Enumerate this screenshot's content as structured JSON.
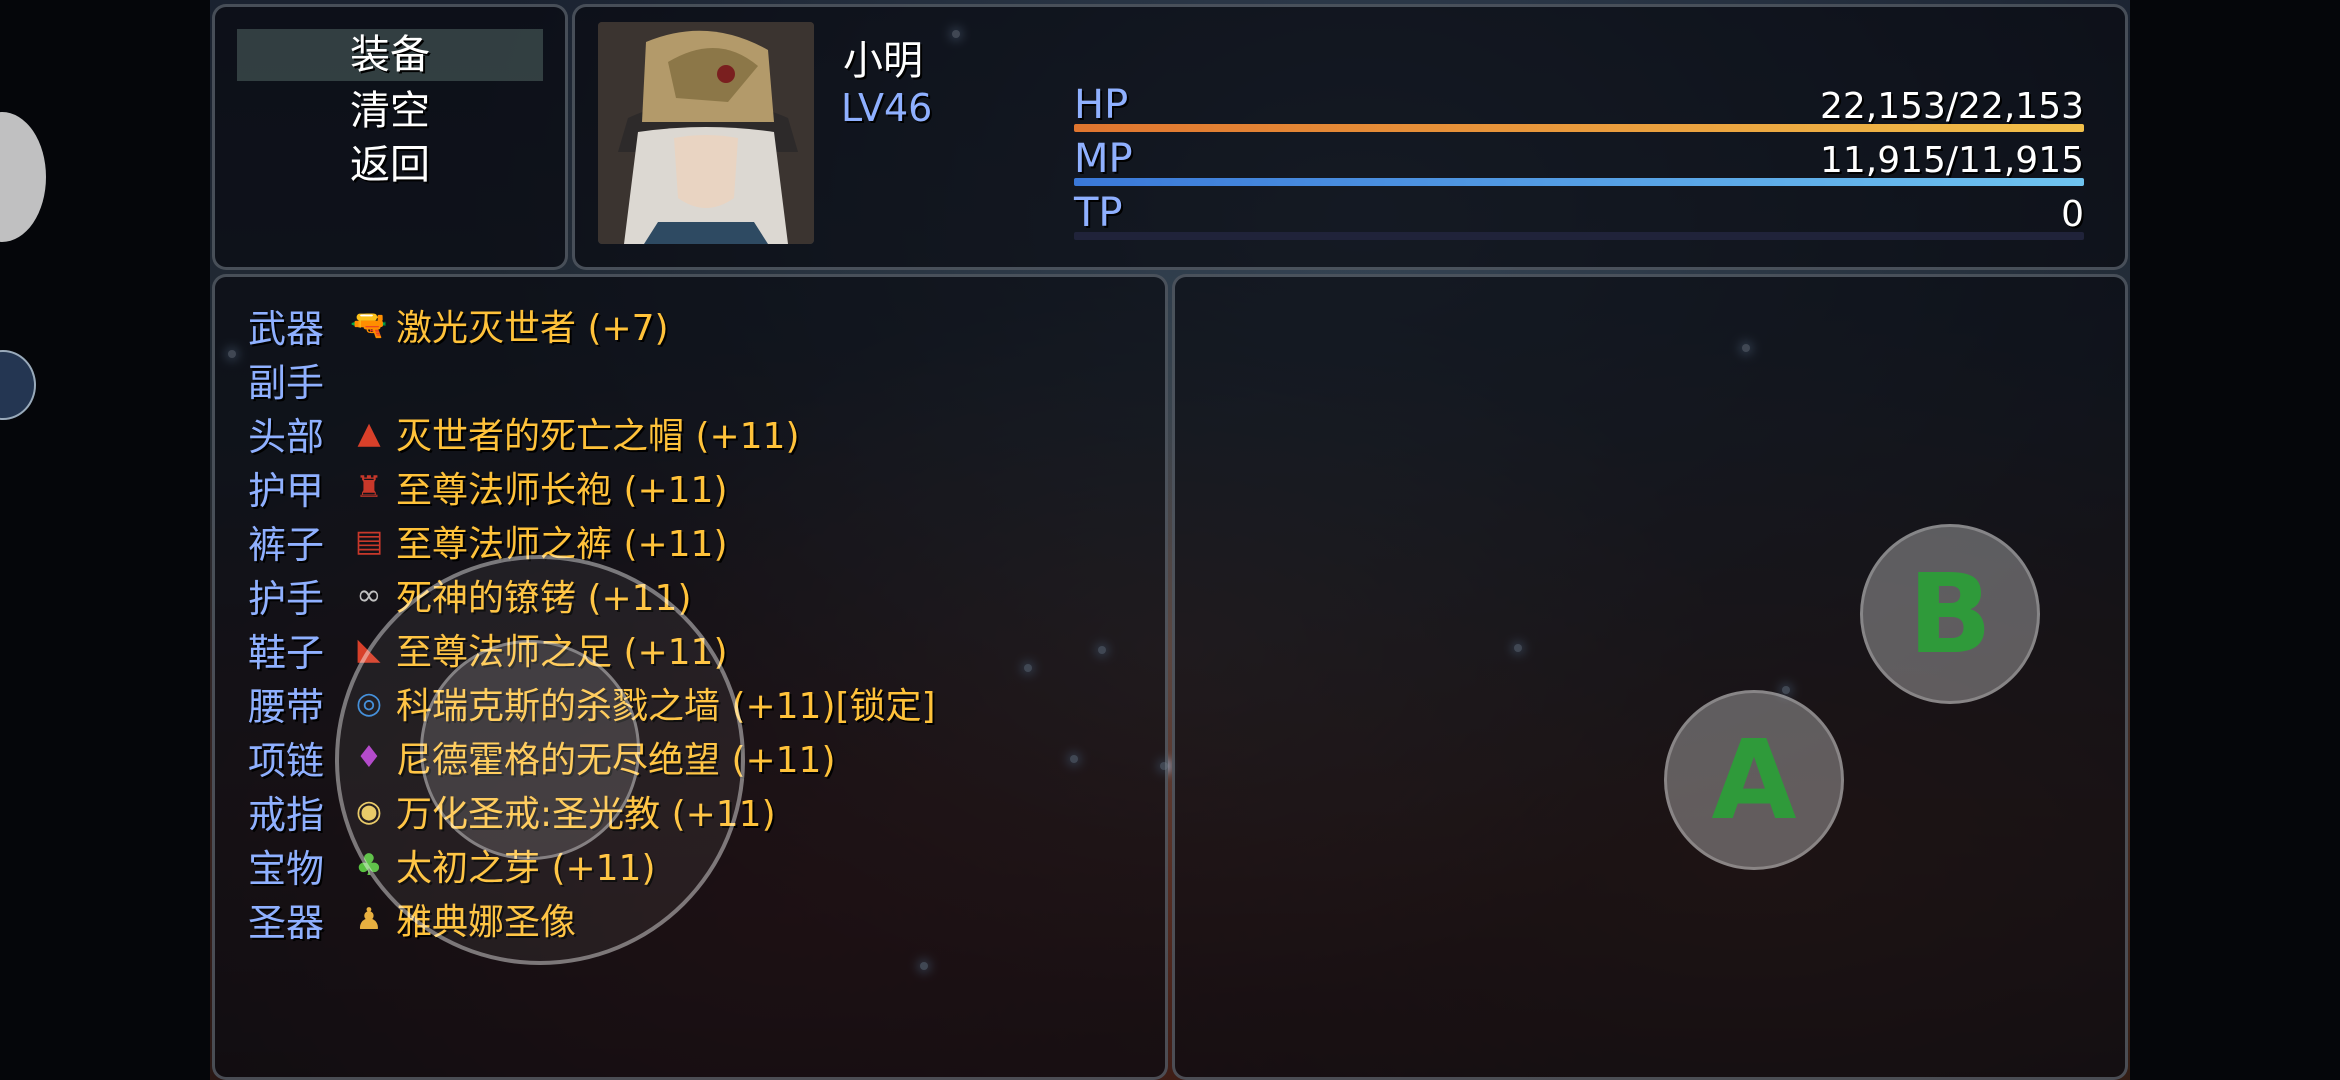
{
  "menu": {
    "items": [
      {
        "label": "装备",
        "selected": true
      },
      {
        "label": "清空",
        "selected": false
      },
      {
        "label": "返回",
        "selected": false
      }
    ]
  },
  "actor": {
    "name": "小明",
    "level": "LV46",
    "hp": {
      "label": "HP",
      "value": "22,153/22,153",
      "ratio": 1.0,
      "colors": [
        "#e0752f",
        "#f2c04a"
      ]
    },
    "mp": {
      "label": "MP",
      "value": "11,915/11,915",
      "ratio": 1.0,
      "colors": [
        "#3a78d8",
        "#6fc4f0"
      ]
    },
    "tp": {
      "label": "TP",
      "value": "0",
      "ratio": 0.0,
      "colors": [
        "#3aa850",
        "#8ed86a"
      ]
    }
  },
  "equipment": [
    {
      "slot": "武器",
      "icon": "laser-gun-icon",
      "item": "激光灭世者 (+7)"
    },
    {
      "slot": "副手",
      "icon": "",
      "item": ""
    },
    {
      "slot": "头部",
      "icon": "red-hat-icon",
      "item": "灭世者的死亡之帽 (+11)"
    },
    {
      "slot": "护甲",
      "icon": "robe-icon",
      "item": "至尊法师长袍 (+11)"
    },
    {
      "slot": "裤子",
      "icon": "pants-icon",
      "item": "至尊法师之裤 (+11)"
    },
    {
      "slot": "护手",
      "icon": "shackles-icon",
      "item": "死神的镣铐 (+11)"
    },
    {
      "slot": "鞋子",
      "icon": "boot-icon",
      "item": "至尊法师之足 (+11)"
    },
    {
      "slot": "腰带",
      "icon": "belt-icon",
      "item": "科瑞克斯的杀戮之墙 (+11)[锁定]"
    },
    {
      "slot": "项链",
      "icon": "necklace-icon",
      "item": "尼德霍格的无尽绝望 (+11)"
    },
    {
      "slot": "戒指",
      "icon": "ring-icon",
      "item": "万化圣戒:圣光教 (+11)"
    },
    {
      "slot": "宝物",
      "icon": "sprout-icon",
      "item": "太初之芽 (+11)"
    },
    {
      "slot": "圣器",
      "icon": "statue-icon",
      "item": "雅典娜圣像"
    }
  ],
  "controls": {
    "a_label": "A",
    "b_label": "B"
  },
  "colors": {
    "system_label": "#8fb0ff",
    "item_text": "#ffc23a",
    "button_glyph": "#2f9a3a"
  }
}
